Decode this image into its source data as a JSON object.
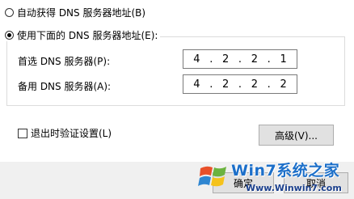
{
  "dns": {
    "auto_option_label": "自动获得 DNS 服务器地址(B)",
    "manual_option_label": "使用下面的 DNS 服务器地址(E):",
    "preferred": {
      "label": "首选 DNS 服务器(P):",
      "octets": [
        "4",
        "2",
        "2",
        "1"
      ]
    },
    "alternate": {
      "label": "备用 DNS 服务器(A):",
      "octets": [
        "4",
        "2",
        "2",
        "2"
      ]
    }
  },
  "validate_on_exit_label": "退出时验证设置(L)",
  "buttons": {
    "advanced_label": "高级(V)...",
    "ok_label": "确定",
    "cancel_label": "取消"
  },
  "watermark": {
    "brand_text": "Win7系统之家",
    "url_text": "Www.Winwin7.com"
  }
}
